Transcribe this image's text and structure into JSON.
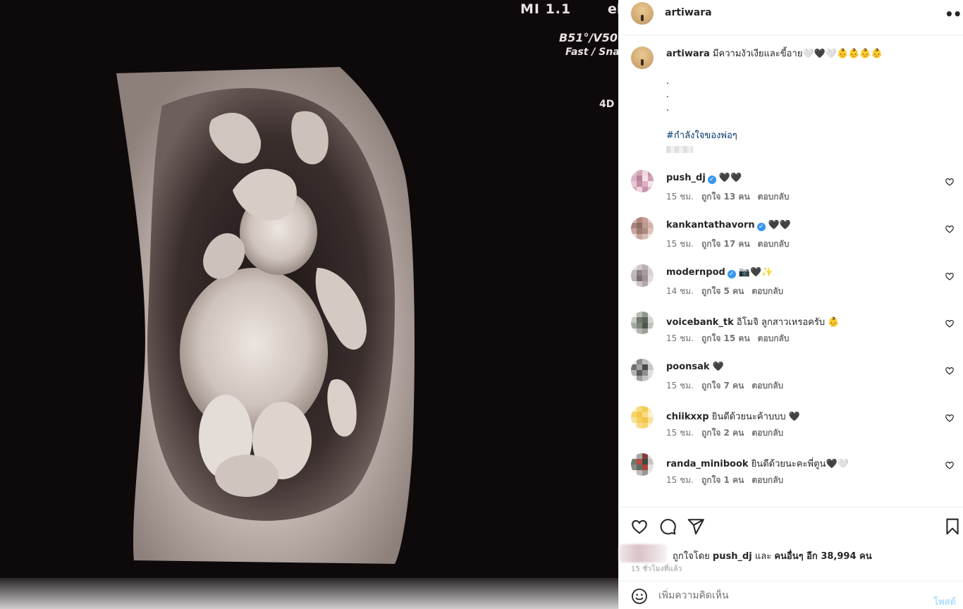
{
  "media": {
    "overlay": {
      "line1": "MI  1.1",
      "line1b": "el",
      "line2": "B51°/V50",
      "line3": "Fast / Sna",
      "line4": "4D"
    }
  },
  "header": {
    "username": "artiwara"
  },
  "caption": {
    "username": "artiwara",
    "text": "มีความงัวเงียและขี้อาย🤍🖤🤍👶👶👶👶",
    "dots": [
      ".",
      ".",
      "."
    ],
    "hashtag": "#กำลังใจของพ่อๆ"
  },
  "comments": [
    {
      "username": "push_dj",
      "verified": true,
      "text": "🖤🖤",
      "time": "15 ชม.",
      "likes": "ถูกใจ 13 คน",
      "reply": "ตอบกลับ",
      "avatar_colors": [
        "#e7c4d2",
        "#d4a6b9",
        "#f0d8e2",
        "#c996ac",
        "#dcb0c4",
        "#b7839b",
        "#f2e1e8",
        "#cfa0b5",
        "#e9c7d4",
        "#c38ea6",
        "#dab0c2",
        "#f4e5eb",
        "#d7a9bd",
        "#efd3df",
        "#c895ab",
        "#e4bfcf"
      ]
    },
    {
      "username": "kankantathavorn",
      "verified": true,
      "text": "🖤🖤",
      "time": "15 ชม.",
      "likes": "ถูกใจ 17 คน",
      "reply": "ตอบกลับ",
      "avatar_colors": [
        "#d9b5ba",
        "#b4857c",
        "#c79e96",
        "#e6c9c7",
        "#a98479",
        "#8f6e63",
        "#b99a8e",
        "#d2b1aa",
        "#c9a79f",
        "#9b7b70",
        "#ad8c80",
        "#e0c3bf",
        "#eedbd8",
        "#c4a59c",
        "#d8bcb5",
        "#f1e4e2"
      ]
    },
    {
      "username": "modernpod",
      "verified": true,
      "text": "📷🖤✨",
      "time": "14 ชม.",
      "likes": "ถูกใจ 5 คน",
      "reply": "ตอบกลับ",
      "avatar_colors": [
        "#e8e4e6",
        "#cfc8cc",
        "#b7aeb3",
        "#dcd6d9",
        "#c2b9be",
        "#8f8388",
        "#a69ba1",
        "#d8d1d5",
        "#bdb3b8",
        "#7a6f74",
        "#9d9196",
        "#e1dbde",
        "#f2eff0",
        "#cbc3c7",
        "#b0a6ab",
        "#ece8ea"
      ]
    },
    {
      "username": "voicebank_tk",
      "verified": false,
      "text": "อิโมจิ ลูกสาวเหรอครับ 👶",
      "time": "15 ชม.",
      "likes": "ถูกใจ 15 คน",
      "reply": "ตอบกลับ",
      "avatar_colors": [
        "#f0f0f0",
        "#b9bcb6",
        "#8f958c",
        "#e5e6e4",
        "#c7cac4",
        "#6f766c",
        "#5c6359",
        "#d2d4d0",
        "#a4a9a1",
        "#7d847a",
        "#4f564c",
        "#c0c3bd",
        "#e9eae8",
        "#b1b5ae",
        "#9aa097",
        "#f4f4f3"
      ]
    },
    {
      "username": "poonsak",
      "verified": false,
      "text": "🖤",
      "time": "15 ชม.",
      "likes": "ถูกใจ 7 คน",
      "reply": "ตอบกลับ",
      "avatar_colors": [
        "#e4e4e4",
        "#8a8a8a",
        "#bdbdbd",
        "#d4d4d4",
        "#6f6f6f",
        "#a3a3a3",
        "#4a4a4a",
        "#c7c7c7",
        "#b2b2b2",
        "#5c5c5c",
        "#8f8f8f",
        "#e0e0e0",
        "#f0f0f0",
        "#9d9d9d",
        "#c2c2c2",
        "#d9d9d9"
      ]
    },
    {
      "username": "chiikxxp",
      "verified": false,
      "text": "ยินดีด้วยนะค้าบบบ 🖤",
      "time": "15 ชม.",
      "likes": "ถูกใจ 2 คน",
      "reply": "ตอบกลับ",
      "avatar_colors": [
        "#fbeec4",
        "#f6d978",
        "#f3cc55",
        "#fae6a8",
        "#f5d46a",
        "#f2c74c",
        "#f7da80",
        "#fdf2d3",
        "#f8e09a",
        "#f4cf5e",
        "#f1c445",
        "#f9e3a0",
        "#fef6df",
        "#f7dc88",
        "#f5d470",
        "#fcedc2"
      ]
    },
    {
      "username": "randa_minibook",
      "verified": false,
      "text": "ยินดีด้วยนะคะพี่ตูน🖤🤍",
      "time": "15 ชม.",
      "likes": "ถูกใจ 1 คน",
      "reply": "ตอบกลับ",
      "avatar_colors": [
        "#f0eeee",
        "#a8a5a4",
        "#7e3f3a",
        "#dad7d6",
        "#6d7a6b",
        "#b94a42",
        "#3f4a3d",
        "#c9c4c2",
        "#8e8a88",
        "#5e6a5c",
        "#a9443d",
        "#e6e2e1",
        "#f4f2f1",
        "#c0bcba",
        "#9a9694",
        "#ebe8e7"
      ]
    }
  ],
  "actions": {
    "liked_by_prefix": "ถูกใจโดย",
    "liked_by_user": "push_dj",
    "liked_by_mid": "และ",
    "liked_by_others": "คนอื่นๆ อีก 38,994 คน",
    "posted_time": "15 ชั่วโมงที่แล้ว"
  },
  "add_comment": {
    "placeholder": "เพิ่มความคิดเห็น",
    "post_label": "โพสต์"
  },
  "colors": {
    "link": "#00376b",
    "verified": "#3897f0",
    "post_button_disabled": "#b2dffc",
    "meta_text": "#737373"
  },
  "icons": {
    "header_more": "more-horizontal-icon",
    "like": "heart-icon",
    "comment": "comment-bubble-icon",
    "share": "paper-plane-icon",
    "save": "bookmark-icon",
    "emoji": "smiley-icon"
  }
}
